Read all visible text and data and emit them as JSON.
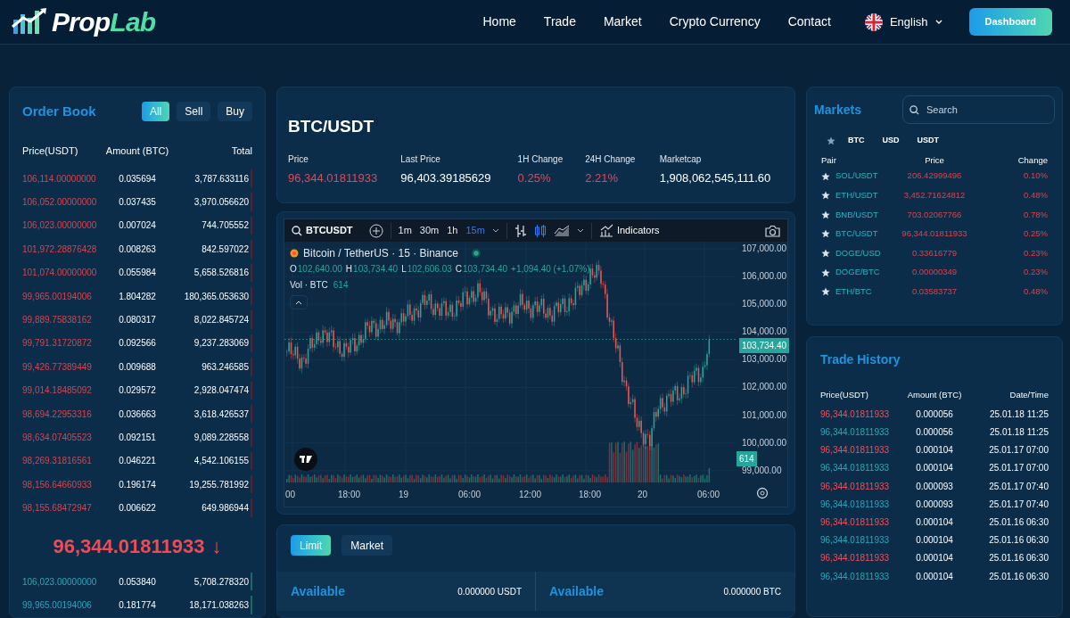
{
  "header": {
    "logo": {
      "part_a": "Prop",
      "part_b": "Lab"
    },
    "nav": [
      {
        "label": "Home"
      },
      {
        "label": "Trade"
      },
      {
        "label": "Market"
      },
      {
        "label": "Crypto Currency"
      },
      {
        "label": "Contact"
      }
    ],
    "language": "English",
    "action": "Dashboard"
  },
  "order_book": {
    "title": "Order Book",
    "filters": [
      {
        "label": "All",
        "selected": true
      },
      {
        "label": "Sell",
        "selected": false
      },
      {
        "label": "Buy",
        "selected": false
      }
    ],
    "columns": [
      "Price(USDT)",
      "Amount (BTC)",
      "Total"
    ],
    "asks": [
      {
        "price": "106,114.00000000",
        "amount": "0.035694",
        "total": "3,787.633116"
      },
      {
        "price": "106,052.00000000",
        "amount": "0.037435",
        "total": "3,970.056620"
      },
      {
        "price": "106,023.00000000",
        "amount": "0.007024",
        "total": "744.705552"
      },
      {
        "price": "101,972.28876428",
        "amount": "0.008263",
        "total": "842.597022"
      },
      {
        "price": "101,074.00000000",
        "amount": "0.055984",
        "total": "5,658.526816"
      },
      {
        "price": "99,965.00194006",
        "amount": "1.804282",
        "total": "180,365.053630"
      },
      {
        "price": "99,889.75838162",
        "amount": "0.080317",
        "total": "8,022.845724"
      },
      {
        "price": "99,791.31720872",
        "amount": "0.092566",
        "total": "9,237.283069"
      },
      {
        "price": "99,426.77389449",
        "amount": "0.009688",
        "total": "963.246585"
      },
      {
        "price": "99,014.18485092",
        "amount": "0.029572",
        "total": "2,928.047474"
      },
      {
        "price": "98,694.22953316",
        "amount": "0.036663",
        "total": "3,618.426537"
      },
      {
        "price": "98,634.07405523",
        "amount": "0.092151",
        "total": "9,089.228558"
      },
      {
        "price": "98,269.31816561",
        "amount": "0.046221",
        "total": "4,542.106155"
      },
      {
        "price": "98,156.64660933",
        "amount": "0.196174",
        "total": "19,255.781992"
      },
      {
        "price": "98,155.68472947",
        "amount": "0.006622",
        "total": "649.986944"
      }
    ],
    "last_price": "96,344.01811933",
    "last_price_arrow": "↓",
    "bids": [
      {
        "price": "106,023.00000000",
        "amount": "0.053840",
        "total": "5,708.278320"
      },
      {
        "price": "99,965.00194006",
        "amount": "0.181774",
        "total": "18,171.038263"
      }
    ]
  },
  "ticker": {
    "symbol": "BTC/USDT",
    "stats": [
      {
        "label": "Price",
        "value": "96,344.01811933",
        "color": "#e0485a"
      },
      {
        "label": "Last Price",
        "value": "96,403.39185629",
        "color": "#ffffff"
      },
      {
        "label": "1H Change",
        "value": "0.25%",
        "color": "#e0485a"
      },
      {
        "label": "24H Change",
        "value": "2.21%",
        "color": "#e0485a"
      },
      {
        "label": "Marketcap",
        "value": "1,908,062,545,111.60",
        "color": "#ffffff"
      }
    ]
  },
  "chart": {
    "symbol": "BTCUSDT",
    "intervals": [
      {
        "label": "1m",
        "selected": false
      },
      {
        "label": "30m",
        "selected": false
      },
      {
        "label": "1h",
        "selected": false
      },
      {
        "label": "15m",
        "selected": true
      }
    ],
    "indicators": "Indicators",
    "legend": "Bitcoin / TetherUS · 15 · Binance",
    "ohlc": [
      {
        "key": "O",
        "value": "102,640.00"
      },
      {
        "key": "H",
        "value": "103,734.40"
      },
      {
        "key": "L",
        "value": "102,606.03"
      },
      {
        "key": "C",
        "value": "103,734.40"
      }
    ],
    "change": "+1,094.40 (+1.07%)",
    "volume_label": "Vol · BTC",
    "volume_value": "614",
    "y_ticks": [
      "107,000.00",
      "106,000.00",
      "105,000.00",
      "104,000.00",
      "103,000.00",
      "102,000.00",
      "101,000.00",
      "100,000.00",
      "99,000.00"
    ],
    "x_ticks": [
      "00",
      "18:00",
      "19",
      "06:00",
      "12:00",
      "18:00",
      "20",
      "06:00"
    ],
    "price_tag": "103,734.40",
    "volume_tag": "614"
  },
  "order_form": {
    "types": [
      {
        "label": "Limit",
        "selected": true
      },
      {
        "label": "Market",
        "selected": false
      }
    ],
    "balances": [
      {
        "label": "Available",
        "value": "0.000000 USDT"
      },
      {
        "label": "Available",
        "value": "0.000000 BTC"
      }
    ]
  },
  "markets": {
    "title": "Markets",
    "search": {
      "placeholder": "Search"
    },
    "quotes": [
      "BTC",
      "USD",
      "USDT"
    ],
    "columns": [
      "Pair",
      "Price",
      "Change"
    ],
    "rows": [
      {
        "pair": "SOL/USDT",
        "price": "206.42999496",
        "change": "0.10%"
      },
      {
        "pair": "ETH/USDT",
        "price": "3,452.71624812",
        "change": "0.48%"
      },
      {
        "pair": "BNB/USDT",
        "price": "703.02067766",
        "change": "0.78%"
      },
      {
        "pair": "BTC/USDT",
        "price": "96,344.01811933",
        "change": "0.25%"
      },
      {
        "pair": "DOGE/USD",
        "price": "0.33616779",
        "change": "0.23%"
      },
      {
        "pair": "DOGE/BTC",
        "price": "0.00000349",
        "change": "0.23%"
      },
      {
        "pair": "ETH/BTC",
        "price": "0.03583737",
        "change": "0.48%"
      }
    ]
  },
  "trade_history": {
    "title": "Trade History",
    "columns": [
      "Price(USDT)",
      "Amount (BTC)",
      "Date/Time"
    ],
    "rows": [
      {
        "price": "96,344.01811933",
        "amount": "0.000056",
        "time": "25.01.18 11:25",
        "color": "#f0505c"
      },
      {
        "price": "96,344.01811933",
        "amount": "0.000056",
        "time": "25.01.18 11:25",
        "color": "#2ba6b8"
      },
      {
        "price": "96,344.01811933",
        "amount": "0.000104",
        "time": "25.01.17 07:00",
        "color": "#f0505c"
      },
      {
        "price": "96,344.01811933",
        "amount": "0.000104",
        "time": "25.01.17 07:00",
        "color": "#2ba6b8"
      },
      {
        "price": "96,344.01811933",
        "amount": "0.000093",
        "time": "25.01.17 07:40",
        "color": "#f0505c"
      },
      {
        "price": "96,344.01811933",
        "amount": "0.000093",
        "time": "25.01.17 07:40",
        "color": "#2ba6b8"
      },
      {
        "price": "96,344.01811933",
        "amount": "0.000104",
        "time": "25.01.16 06:30",
        "color": "#f0505c"
      },
      {
        "price": "96,344.01811933",
        "amount": "0.000104",
        "time": "25.01.16 06:30",
        "color": "#2ba6b8"
      },
      {
        "price": "96,344.01811933",
        "amount": "0.000104",
        "time": "25.01.16 06:30",
        "color": "#f0505c"
      },
      {
        "price": "96,344.01811933",
        "amount": "0.000104",
        "time": "25.01.16 06:30",
        "color": "#2ba6b8"
      }
    ]
  }
}
